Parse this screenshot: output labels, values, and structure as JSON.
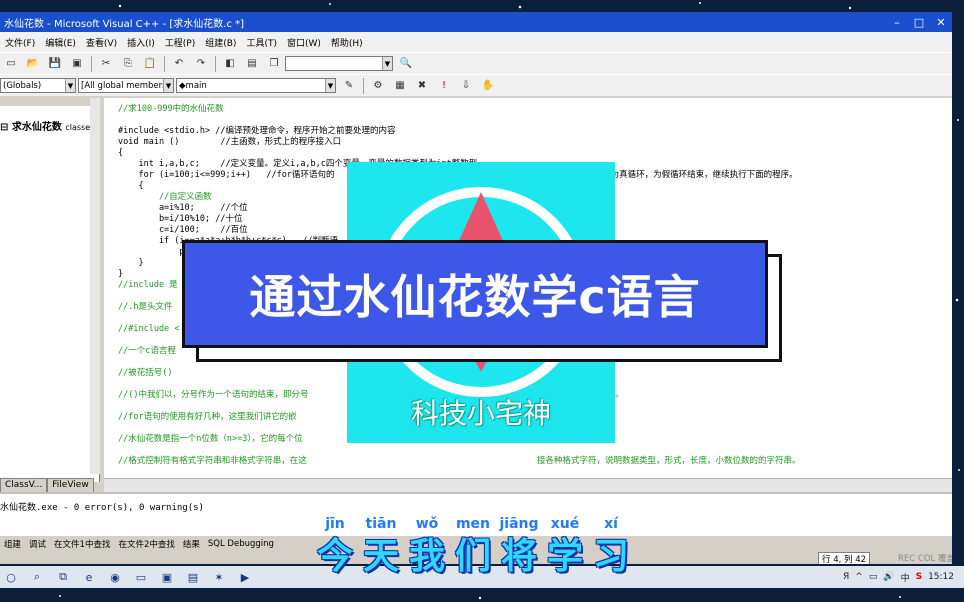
{
  "window": {
    "title": "水仙花数 - Microsoft Visual C++ - [求水仙花数.c *]",
    "controls": [
      "–",
      "□",
      "✕"
    ]
  },
  "menu": [
    "文件(F)",
    "编辑(E)",
    "查看(V)",
    "插入(I)",
    "工程(P)",
    "组建(B)",
    "工具(T)",
    "窗口(W)",
    "帮助(H)"
  ],
  "toolbar": {
    "combo_blank": "",
    "combo_globals": "(Globals)",
    "combo_members": "[All global members]",
    "combo_func": "◆main",
    "combo_dd": "▼",
    "icons": [
      "new-file-icon",
      "open-icon",
      "save-icon",
      "save-all-icon",
      "cut-icon",
      "copy-icon",
      "paste-icon",
      "undo-icon",
      "redo-icon",
      "workspace-icon",
      "output-icon",
      "window-list-icon",
      "find-icon"
    ]
  },
  "workspace": {
    "root": "求水仙花数",
    "root_suffix": "classe",
    "tabs": [
      "ClassV...",
      "FileView"
    ]
  },
  "editor": {
    "lines": [
      "//求100-999中的水仙花数",
      "",
      "#include <stdio.h> //编译预处理命令，程序开始之前要处理的内容",
      "void main ()        //主函数，形式上的程序接入口",
      "{",
      "    int i,a,b,c;    //定义变量。定义i,a,b,c四个变量，变量的数据类型为int整数型",
      "    for (i=100;i<=999;i++)   //for循环语句的                                       用于判断，循环的值为真循环，为假循环结束，继续执行下面的程序。",
      "    {",
      "        //自定义函数",
      "        a=i%10;     //个位",
      "        b=i/10%10; //十位",
      "        c=i/100;    //百位",
      "        if (i==a*a*a+b*b*b+c*c*c)   //判断语",
      "            printf (\"%5d \",i);      //格式输                                          里的\"%d\"表示十进制整型输出",
      "    }",
      "}",
      "//include 是",
      "",
      "//.h是头文件                                                                                              数等。",
      "",
      "//#include <",
      "",
      "//一个c语言程",
      "",
      "//被花括号()",
      "",
      "//()中我们以，分号作为一个语句的结束，即分号                                             子函数后面不要分号。",
      "",
      "//for语句的使用有好几种，这里我们讲它的嵌                                   *) () 。",
      "",
      "//水仙花数是指一个n位数（n>=3），它的每个位                                         n。",
      "",
      "//格式控制符有格式字符串和非格式字符串，在这                                             接各种格式字符，说明数据类型，形式，长度，小数位数的的字符串。"
    ]
  },
  "output": {
    "build_result": "水仙花数.exe - 0 error(s), 0 warning(s)",
    "tabs": [
      "组建",
      "调试",
      "在文件1中查找",
      "在文件2中查找",
      "结果",
      "SQL Debugging"
    ]
  },
  "status": {
    "position": "行 4, 列 42",
    "indicators": "REC COL 覆盖 读取"
  },
  "overlay": {
    "banner_title": "通过水仙花数学c语言",
    "brand": "科技小宅神",
    "subtitle": [
      {
        "py": "jīn",
        "hz": "今"
      },
      {
        "py": "tiān",
        "hz": "天"
      },
      {
        "py": "wǒ",
        "hz": "我"
      },
      {
        "py": "men",
        "hz": "们"
      },
      {
        "py": "jiāng",
        "hz": "将"
      },
      {
        "py": "xué",
        "hz": "学"
      },
      {
        "py": "xí",
        "hz": "习"
      }
    ]
  },
  "taskbar": {
    "apps": [
      "start-icon",
      "search-icon",
      "task-view-icon",
      "edge-icon",
      "browser-icon",
      "files-icon",
      "photos-icon",
      "vc-icon",
      "app-icon",
      "media-icon"
    ],
    "tray": [
      "Я",
      "^",
      "▭",
      "🔊",
      "中",
      "S"
    ],
    "time": "15:12"
  },
  "colors": {
    "title_bar": "#1a4fd0",
    "comment": "#1f9b1f",
    "keyword": "#1010c8",
    "banner": "#3d57e8",
    "logo_bg": "#1ee6ee",
    "subtitle_text": "#2fd8ff",
    "pinyin": "#1e7bff"
  }
}
